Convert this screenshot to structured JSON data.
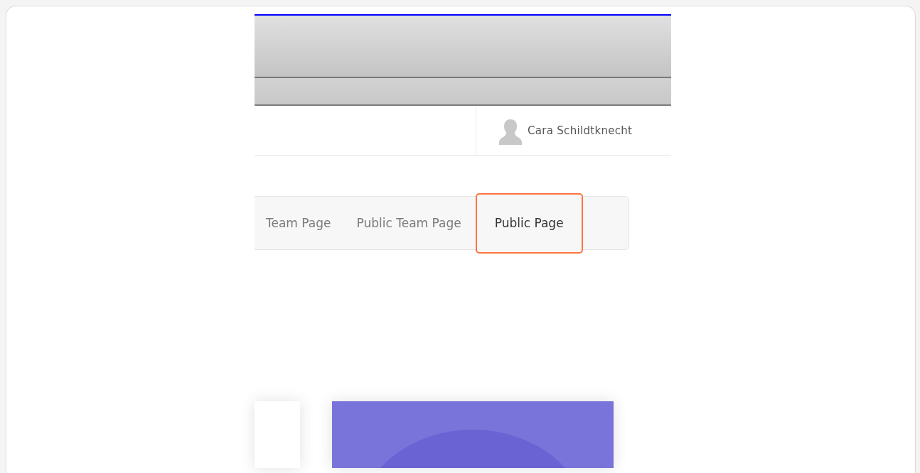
{
  "header": {
    "user_name": "Cara Schildtknecht"
  },
  "tabs": [
    {
      "label": "Team Page",
      "selected": false
    },
    {
      "label": "Public Team Page",
      "selected": false
    },
    {
      "label": "Public Page",
      "selected": true
    }
  ],
  "cards": [
    {
      "kind": "blank"
    },
    {
      "kind": "picture"
    }
  ]
}
